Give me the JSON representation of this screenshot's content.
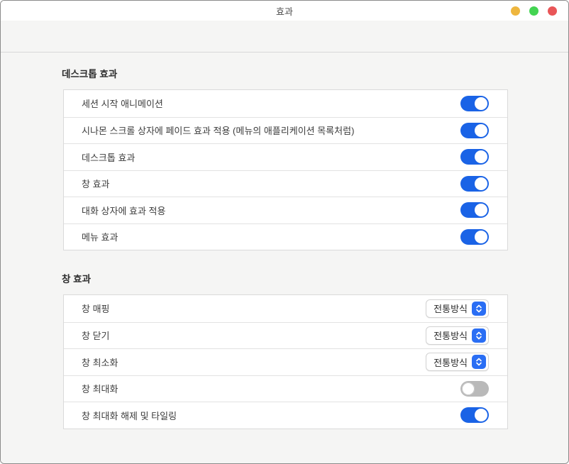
{
  "window": {
    "title": "효과",
    "controls": {
      "minimize": "minimize-button",
      "maximize": "maximize-button",
      "close": "close-button"
    }
  },
  "colors": {
    "accent_blue": "#1a63e6",
    "toggle_off_gray": "#b9b9b9",
    "traffic_yellow": "#eeb63e",
    "traffic_green": "#43d452",
    "traffic_red": "#e95658",
    "content_bg": "#f5f5f4",
    "panel_bg": "#ffffff"
  },
  "sections": [
    {
      "heading": "데스크톱 효과",
      "rows": [
        {
          "label": "세션 시작 애니메이션",
          "control": {
            "type": "toggle",
            "state": "on"
          }
        },
        {
          "label": "시나몬 스크롤 상자에 페이드 효과 적용 (메뉴의 애플리케이션 목록처럼)",
          "control": {
            "type": "toggle",
            "state": "on"
          }
        },
        {
          "label": "데스크톱 효과",
          "control": {
            "type": "toggle",
            "state": "on"
          }
        },
        {
          "label": "창 효과",
          "control": {
            "type": "toggle",
            "state": "on"
          }
        },
        {
          "label": "대화 상자에 효과 적용",
          "control": {
            "type": "toggle",
            "state": "on"
          }
        },
        {
          "label": "메뉴 효과",
          "control": {
            "type": "toggle",
            "state": "on"
          }
        }
      ]
    },
    {
      "heading": "창 효과",
      "rows": [
        {
          "label": "창 매핑",
          "control": {
            "type": "select",
            "value": "전통방식"
          }
        },
        {
          "label": "창 닫기",
          "control": {
            "type": "select",
            "value": "전통방식"
          }
        },
        {
          "label": "창 최소화",
          "control": {
            "type": "select",
            "value": "전통방식"
          }
        },
        {
          "label": "창 최대화",
          "control": {
            "type": "toggle",
            "state": "off"
          }
        },
        {
          "label": "창 최대화 해제 및 타일링",
          "control": {
            "type": "toggle",
            "state": "on"
          }
        }
      ]
    }
  ]
}
